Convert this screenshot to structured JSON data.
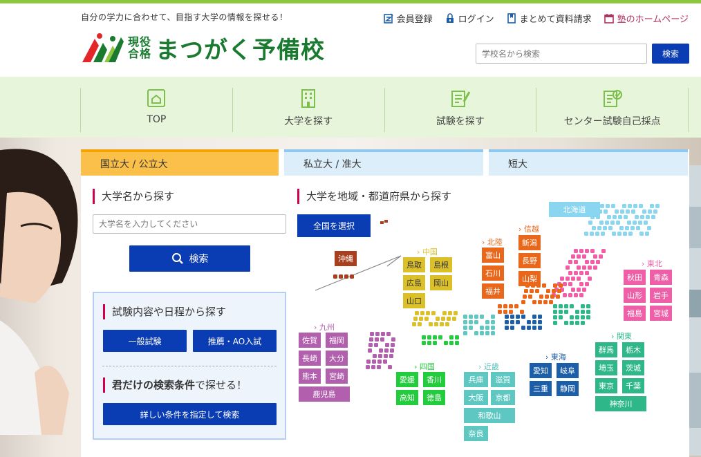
{
  "header": {
    "tagline": "自分の学力に合わせて、目指す大学の情報を探せる！",
    "links": [
      {
        "label": "会員登録",
        "icon": "register-icon"
      },
      {
        "label": "ログイン",
        "icon": "lock-icon"
      },
      {
        "label": "まとめて資料請求",
        "icon": "bookmark-icon"
      },
      {
        "label": "塾のホームページ",
        "icon": "calendar-icon"
      }
    ],
    "logo_sub1": "現役",
    "logo_sub2": "合格",
    "logo_main": "まつがく予備校",
    "search_placeholder": "学校名から検索",
    "search_button": "検索"
  },
  "gnav": [
    {
      "label": "TOP",
      "icon": "home-icon"
    },
    {
      "label": "大学を探す",
      "icon": "building-icon"
    },
    {
      "label": "試験を探す",
      "icon": "document-pen-icon"
    },
    {
      "label": "センター試験自己採点",
      "icon": "check-document-icon"
    }
  ],
  "tabs": [
    "国立大 / 公立大",
    "私立大 / 准大",
    "短大"
  ],
  "left": {
    "title": "大学名から探す",
    "input_placeholder": "大学名を入力してください",
    "search_button": "検索",
    "exam_title": "試験内容や日程から探す",
    "exam_btn1": "一般試験",
    "exam_btn2": "推薦・AO入試",
    "cond_title_bold": "君だけの検索条件",
    "cond_title_rest": "で探せる！",
    "cond_button": "詳しい条件を指定して検索"
  },
  "right": {
    "title": "大学を地域・都道府県から探す",
    "all_button": "全国を選択"
  },
  "regions": {
    "hokkaido": "北海道",
    "tohoku": "› 東北",
    "kanto": "› 関東",
    "shinetsu": "› 信越",
    "hokuriku": "› 北陸",
    "tokai": "› 東海",
    "kinki": "› 近畿",
    "chugoku": "› 中国",
    "shikoku": "› 四国",
    "kyushu": "› 九州"
  },
  "prefs": {
    "okinawa": "沖縄",
    "tottori": "鳥取",
    "shimane": "島根",
    "hiroshima": "広島",
    "okayama": "岡山",
    "yamaguchi": "山口",
    "toyama": "富山",
    "ishikawa": "石川",
    "fukui": "福井",
    "niigata": "新潟",
    "nagano": "長野",
    "yamanashi": "山梨",
    "akita": "秋田",
    "aomori": "青森",
    "yamagata": "山形",
    "iwate": "岩手",
    "fukushima": "福島",
    "miyagi": "宮城",
    "saga": "佐賀",
    "fukuoka": "福岡",
    "nagasaki": "長崎",
    "oita": "大分",
    "kumamoto": "熊本",
    "miyazaki": "宮崎",
    "kagoshima": "鹿児島",
    "ehime": "愛媛",
    "kagawa": "香川",
    "kochi": "高知",
    "tokushima": "徳島",
    "hyogo": "兵庫",
    "shiga": "滋賀",
    "osaka": "大阪",
    "kyoto": "京都",
    "wakayama": "和歌山",
    "nara": "奈良",
    "aichi": "愛知",
    "gifu": "岐阜",
    "mie": "三重",
    "shizuoka": "静岡",
    "gunma": "群馬",
    "tochigi": "栃木",
    "saitama": "埼玉",
    "ibaraki": "茨城",
    "tokyo": "東京",
    "chiba": "千葉",
    "kanagawa": "神奈川"
  },
  "colors": {
    "brand_green": "#1a7a30",
    "primary_blue": "#0a3cb4",
    "accent_red": "#d0004f",
    "hokkaido": "#8ad6f0",
    "tohoku": "#ee5fa7",
    "kanto": "#2eb88a",
    "shinetsu": "#e8671a",
    "hokuriku": "#e8671a",
    "tokai": "#1d5ea8",
    "kinki": "#5ec7c2",
    "chugoku": "#dbc02a",
    "shikoku": "#22cc3c",
    "kyushu": "#b25fae",
    "okinawa": "#a8401f"
  }
}
